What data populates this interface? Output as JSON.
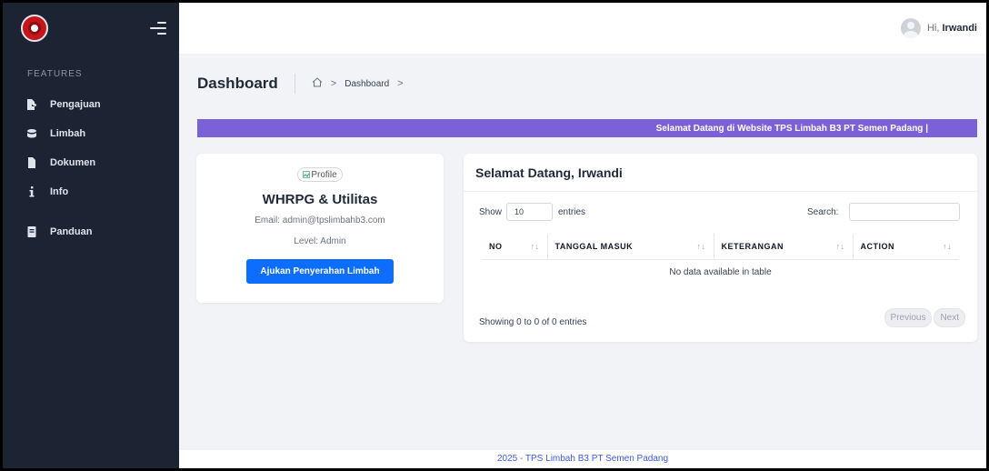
{
  "sidebar": {
    "section_label": "FEATURES",
    "items": [
      {
        "label": "Pengajuan",
        "icon": "file-export-icon"
      },
      {
        "label": "Limbah",
        "icon": "database-icon"
      },
      {
        "label": "Dokumen",
        "icon": "document-icon"
      },
      {
        "label": "Info",
        "icon": "info-icon"
      },
      {
        "label": "Panduan",
        "icon": "book-icon"
      }
    ]
  },
  "header": {
    "greeting": "Hi, ",
    "user_name": "Irwandi"
  },
  "breadcrumb": {
    "page_title": "Dashboard",
    "current": "Dashboard"
  },
  "marquee_text": "Selamat Datang di Website TPS Limbah B3 PT Semen Padang |",
  "profile": {
    "image_alt": "Profile",
    "name": "WHRPG & Utilitas",
    "email": "Email: admin@tpslimbahb3.com",
    "level": "Level: Admin",
    "button_label": "Ajukan Penyerahan Limbah"
  },
  "table_card": {
    "title": "Selamat Datang, Irwandi",
    "show_label": "Show",
    "show_value": "10",
    "entries_label": "entries",
    "search_label": "Search:",
    "columns": [
      "NO",
      "TANGGAL MASUK",
      "KETERANGAN",
      "ACTION"
    ],
    "empty_message": "No data available in table",
    "info": "Showing 0 to 0 of 0 entries",
    "prev_label": "Previous",
    "next_label": "Next"
  },
  "footer_text": "2025 - TPS Limbah B3 PT Semen Padang",
  "colors": {
    "sidebar_bg": "#1c2434",
    "marquee_bg": "#7b61d8",
    "primary_button": "#0d6efd",
    "footer_link": "#3b5bdb"
  }
}
